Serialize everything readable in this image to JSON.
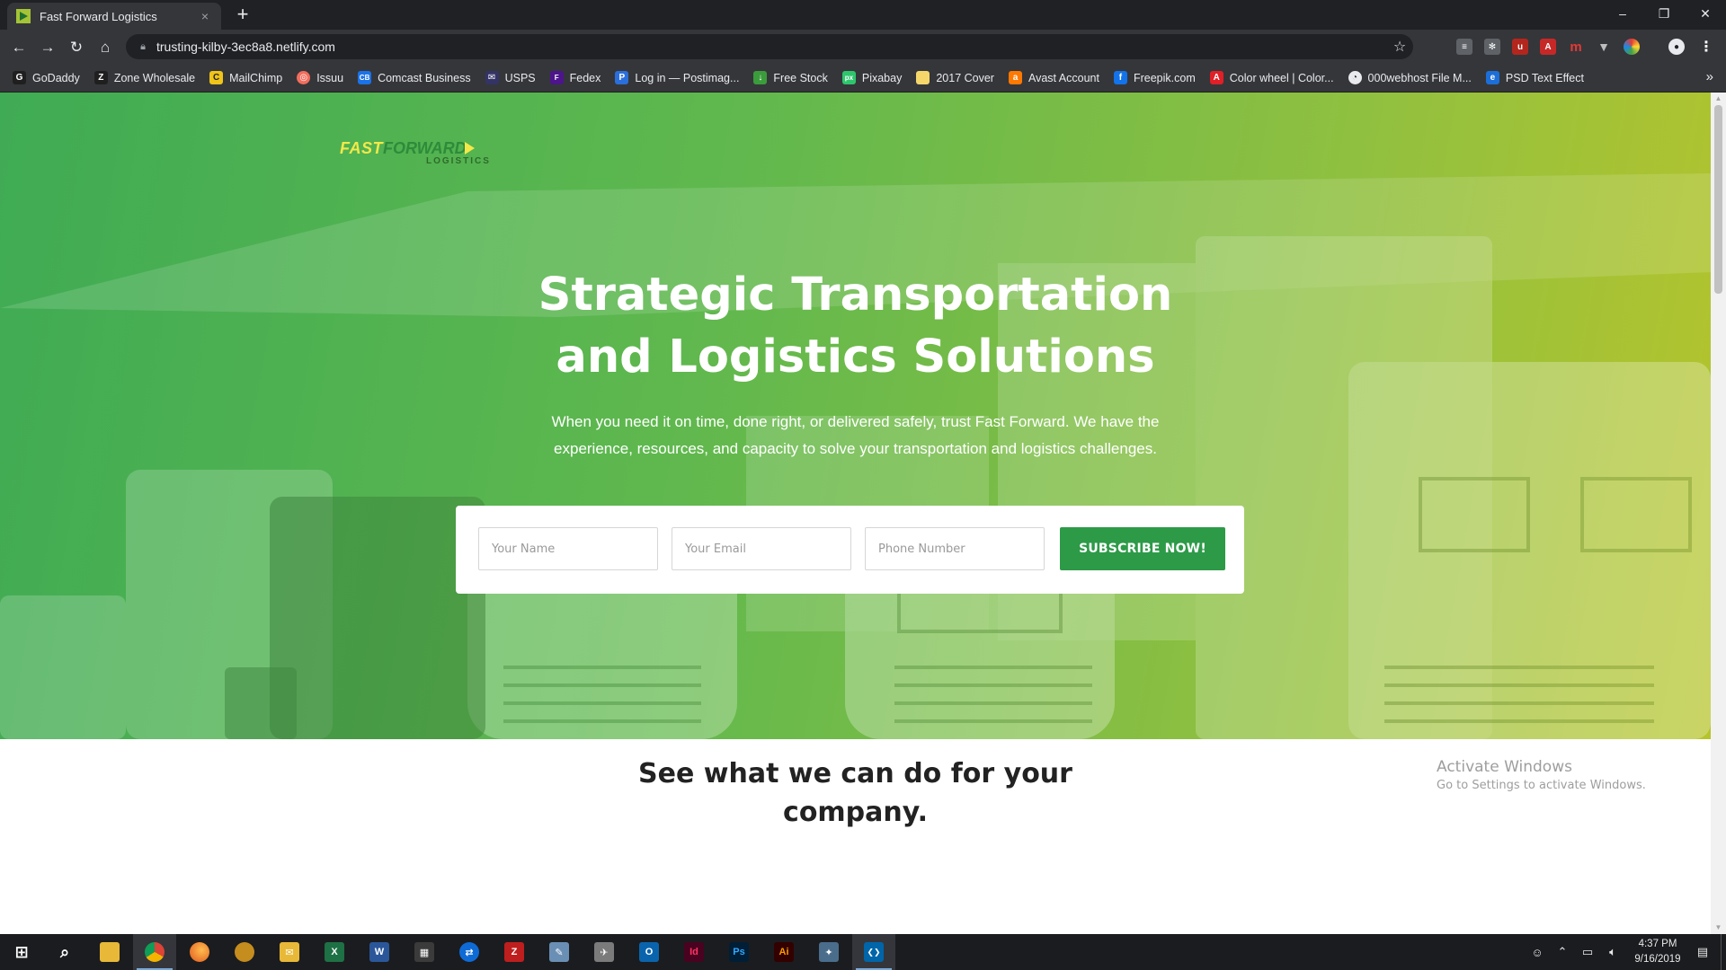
{
  "browser": {
    "tab_title": "Fast Forward Logistics",
    "tab_close": "×",
    "new_tab": "+",
    "url": "trusting-kilby-3ec8a8.netlify.com",
    "window": {
      "minimize": "–",
      "restore": "❐",
      "close": "✕"
    },
    "nav": {
      "back": "←",
      "forward": "→",
      "reload": "↻",
      "home": "⌂"
    },
    "bookmarks": [
      {
        "label": "GoDaddy",
        "icon": "godaddy-icon",
        "color": "#1f1f1f",
        "glyph": "G"
      },
      {
        "label": "Zone Wholesale",
        "icon": "zone-icon",
        "color": "#1f1f1f",
        "glyph": "Z"
      },
      {
        "label": "MailChimp",
        "icon": "mailchimp-icon",
        "color": "#f0c419",
        "glyph": "C"
      },
      {
        "label": "Issuu",
        "icon": "issuu-icon",
        "color": "#f36d5d",
        "glyph": "◎"
      },
      {
        "label": "Comcast Business",
        "icon": "comcast-icon",
        "color": "#1a73e8",
        "glyph": "CB"
      },
      {
        "label": "USPS",
        "icon": "usps-icon",
        "color": "#333366",
        "glyph": "✉"
      },
      {
        "label": "Fedex",
        "icon": "fedex-icon",
        "color": "#4d148c",
        "glyph": "F"
      },
      {
        "label": "Log in — Postimag...",
        "icon": "postimage-icon",
        "color": "#2a6fdb",
        "glyph": "P"
      },
      {
        "label": "Free Stock",
        "icon": "freestock-icon",
        "color": "#3b9c3b",
        "glyph": "↓"
      },
      {
        "label": "Pixabay",
        "icon": "pixabay-icon",
        "color": "#2ec66d",
        "glyph": "px"
      },
      {
        "label": "2017 Cover",
        "icon": "doc-icon",
        "color": "#f5d66b",
        "glyph": ""
      },
      {
        "label": "Avast Account",
        "icon": "avast-icon",
        "color": "#ff7800",
        "glyph": "a"
      },
      {
        "label": "Freepik.com",
        "icon": "freepik-icon",
        "color": "#1273eb",
        "glyph": "f"
      },
      {
        "label": "Color wheel | Color...",
        "icon": "adobe-icon",
        "color": "#e01f26",
        "glyph": "A"
      },
      {
        "label": "000webhost File M...",
        "icon": "webhost-icon",
        "color": "#444444",
        "glyph": "◔"
      },
      {
        "label": "PSD Text Effect",
        "icon": "psd-icon",
        "color": "#1c6fd8",
        "glyph": "e"
      }
    ],
    "bookmarks_more": "»",
    "star": "☆"
  },
  "page": {
    "logo": {
      "fast": "FAST",
      "forward": "FORWARD",
      "sub": "LOGISTICS"
    },
    "hero_title_line1": "Strategic Transportation",
    "hero_title_line2": "and Logistics Solutions",
    "hero_sub_line1": "When you need it on time, done right, or delivered safely, trust Fast Forward. We have the",
    "hero_sub_line2": "experience, resources, and capacity to solve your transportation and logistics challenges.",
    "form": {
      "name_placeholder": "Your Name",
      "email_placeholder": "Your Email",
      "phone_placeholder": "Phone Number",
      "submit_label": "SUBSCRIBE NOW!"
    },
    "section_title_line1": "See what we can do for your",
    "section_title_line2": "company.",
    "watermark_line1": "Activate Windows",
    "watermark_line2": "Go to Settings to activate Windows."
  },
  "colors": {
    "accent": "#2d9a48",
    "hero_gradient_start": "#3fab54",
    "hero_gradient_end": "#b6c42c"
  },
  "taskbar": {
    "apps": [
      {
        "name": "start-button",
        "glyph": "⊞",
        "color": "transparent"
      },
      {
        "name": "search-button",
        "glyph": "⌕",
        "color": "transparent"
      },
      {
        "name": "file-explorer-icon",
        "glyph": "▭",
        "color": "#e8b938"
      },
      {
        "name": "chrome-icon",
        "glyph": "◉",
        "color": "#2e9e48"
      },
      {
        "name": "firefox-icon",
        "glyph": "◐",
        "color": "#e0561c"
      },
      {
        "name": "app-icon",
        "glyph": "◍",
        "color": "#c58c1e"
      },
      {
        "name": "mail-icon",
        "glyph": "✉",
        "color": "#e8b938"
      },
      {
        "name": "excel-icon",
        "glyph": "X",
        "color": "#1e7145"
      },
      {
        "name": "word-icon",
        "glyph": "W",
        "color": "#2b579a"
      },
      {
        "name": "calculator-icon",
        "glyph": "▦",
        "color": "#3b3b3b"
      },
      {
        "name": "teamviewer-icon",
        "glyph": "⇄",
        "color": "#0e6bd6"
      },
      {
        "name": "filezilla-icon",
        "glyph": "Z",
        "color": "#bf1e1e"
      },
      {
        "name": "notepad-icon",
        "glyph": "✎",
        "color": "#6a8fb5"
      },
      {
        "name": "app-icon-2",
        "glyph": "✈",
        "color": "#7b7b7b"
      },
      {
        "name": "outlook-icon",
        "glyph": "O",
        "color": "#0a64ad"
      },
      {
        "name": "indesign-icon",
        "glyph": "Id",
        "color": "#49021f"
      },
      {
        "name": "photoshop-icon",
        "glyph": "Ps",
        "color": "#001e36"
      },
      {
        "name": "illustrator-icon",
        "glyph": "Ai",
        "color": "#330000"
      },
      {
        "name": "app-icon-3",
        "glyph": "✦",
        "color": "#4a6d8c"
      },
      {
        "name": "vscode-icon",
        "glyph": "❮❯",
        "color": "#0065a9"
      }
    ],
    "time": "4:37 PM",
    "date": "9/16/2019"
  }
}
